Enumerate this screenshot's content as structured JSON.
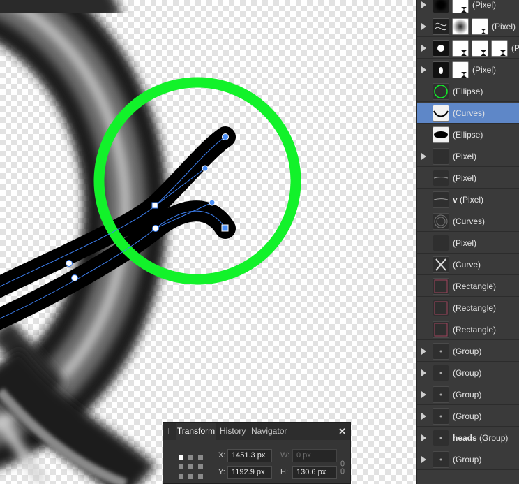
{
  "layers": [
    {
      "label": "(Pixel)",
      "expandable": true,
      "thumbs": [
        "blur-dark-thumb",
        "mask-thumb"
      ],
      "selected": false
    },
    {
      "label": "(Pixel)",
      "expandable": true,
      "thumbs": [
        "pattern-thumb",
        "soft-thumb",
        "mask-thumb"
      ],
      "selected": false
    },
    {
      "label": "(P",
      "expandable": true,
      "thumbs": [
        "glow-thumb",
        "mask-thumb",
        "mask-thumb",
        "mask-thumb"
      ],
      "selected": false
    },
    {
      "label": "(Pixel)",
      "expandable": true,
      "thumbs": [
        "spot-thumb",
        "mask-thumb"
      ],
      "selected": false
    },
    {
      "label": "(Ellipse)",
      "expandable": false,
      "thumbs": [
        "green-ring-thumb"
      ],
      "selected": false
    },
    {
      "label": "(Curves)",
      "expandable": false,
      "thumbs": [
        "curve-thumb"
      ],
      "selected": true
    },
    {
      "label": "(Ellipse)",
      "expandable": false,
      "thumbs": [
        "black-ellipse-thumb"
      ],
      "selected": false
    },
    {
      "label": "(Pixel)",
      "expandable": true,
      "thumbs": [
        "blank-thumb"
      ],
      "selected": false
    },
    {
      "label": "(Pixel)",
      "expandable": false,
      "thumbs": [
        "line-thumb"
      ],
      "selected": false
    },
    {
      "prefix": "v",
      "label": "(Pixel)",
      "expandable": false,
      "thumbs": [
        "line-thumb"
      ],
      "selected": false
    },
    {
      "label": "(Curves)",
      "expandable": false,
      "thumbs": [
        "rings-thumb"
      ],
      "selected": false
    },
    {
      "label": "(Pixel)",
      "expandable": false,
      "thumbs": [
        "blank-thumb"
      ],
      "selected": false
    },
    {
      "label": "(Curve)",
      "expandable": false,
      "thumbs": [
        "cross-thumb"
      ],
      "selected": false
    },
    {
      "label": "(Rectangle)",
      "expandable": false,
      "thumbs": [
        "rect-thumb"
      ],
      "selected": false
    },
    {
      "label": "(Rectangle)",
      "expandable": false,
      "thumbs": [
        "rect-thumb"
      ],
      "selected": false
    },
    {
      "label": "(Rectangle)",
      "expandable": false,
      "thumbs": [
        "rect-thumb"
      ],
      "selected": false
    },
    {
      "label": "(Group)",
      "expandable": true,
      "thumbs": [
        "dot-thumb"
      ],
      "selected": false
    },
    {
      "label": "(Group)",
      "expandable": true,
      "thumbs": [
        "dot-thumb"
      ],
      "selected": false
    },
    {
      "label": "(Group)",
      "expandable": true,
      "thumbs": [
        "dot-thumb"
      ],
      "selected": false
    },
    {
      "label": "(Group)",
      "expandable": true,
      "thumbs": [
        "dot-thumb"
      ],
      "selected": false
    },
    {
      "prefix": "heads",
      "label": "(Group)",
      "expandable": true,
      "thumbs": [
        "dot-thumb"
      ],
      "selected": false
    },
    {
      "label": "(Group)",
      "expandable": true,
      "thumbs": [
        "dot-thumb"
      ],
      "selected": false
    }
  ],
  "transform_panel": {
    "tabs": [
      "Transform",
      "History",
      "Navigator"
    ],
    "active_tab": "Transform",
    "close_icon": "close-icon",
    "x_label": "X:",
    "x_value": "1451.3 px",
    "y_label": "Y:",
    "y_value": "1192.9 px",
    "w_label": "W:",
    "w_value": "0 px",
    "h_label": "H:",
    "h_value": "130.6 px"
  },
  "colors": {
    "accent_ring": "#12f22a",
    "selection": "#5e87c8",
    "path_blue": "#3d7ff0",
    "panel_bg": "#3a3a3a"
  }
}
